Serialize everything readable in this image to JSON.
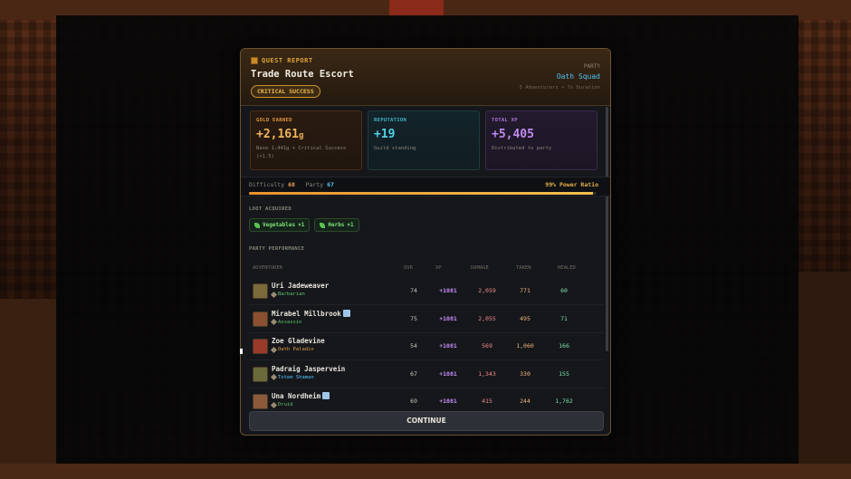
{
  "dialog": {
    "report_label": "QUEST REPORT",
    "quest_title": "Trade Route Escort",
    "outcome": "CRITICAL SUCCESS",
    "party_label": "PARTY",
    "party_name": "Oath Squad",
    "party_meta": "5 Adventurers • 7s Duration"
  },
  "stats": {
    "gold": {
      "label": "GOLD EARNED",
      "value": "+2,161",
      "unit": "g",
      "note": "Base 1,441g + Critical Success (×1.5)",
      "color": "#f0b45a"
    },
    "reputation": {
      "label": "REPUTATION",
      "value": "+19",
      "note": "Guild standing",
      "color": "#4fd2e6"
    },
    "xp": {
      "label": "TOTAL XP",
      "value": "+5,405",
      "note": "Distributed to party",
      "color": "#c08af0"
    }
  },
  "power": {
    "difficulty_label": "Difficulty",
    "difficulty": "68",
    "party_label": "Party",
    "party": "67",
    "ratio_text": "99% Power Ratio",
    "ratio": 0.99
  },
  "loot": {
    "label": "LOOT ACQUIRED",
    "items": [
      {
        "label": "Vegetables",
        "qty": "×1"
      },
      {
        "label": "Herbs",
        "qty": "×1"
      }
    ]
  },
  "performance": {
    "label": "PARTY PERFORMANCE",
    "columns": {
      "adventurer": "ADVENTURER",
      "ovr": "OVR",
      "xp": "XP",
      "damage": "DAMAGE",
      "taken": "TAKEN",
      "healed": "HEALED"
    },
    "rows": [
      {
        "name": "Uri Jadeweaver",
        "verified": false,
        "class": "Barbarian",
        "class_color": "#5ec46a",
        "ovr": "74",
        "xp": "+1081",
        "damage": "2,059",
        "taken": "771",
        "healed": "60",
        "avatar_color": "#7a6a3a"
      },
      {
        "name": "Mirabel Millbrook",
        "verified": true,
        "class": "Assassin",
        "class_color": "#5ec46a",
        "ovr": "75",
        "xp": "+1081",
        "damage": "2,055",
        "taken": "495",
        "healed": "71",
        "avatar_color": "#8a5030"
      },
      {
        "name": "Zoe Gladevine",
        "verified": false,
        "class": "Oath Paladin",
        "class_color": "#e0a040",
        "ovr": "54",
        "xp": "+1081",
        "damage": "569",
        "taken": "1,060",
        "healed": "166",
        "avatar_color": "#9a3a2a"
      },
      {
        "name": "Padraig Jaspervein",
        "verified": false,
        "class": "Totem Shaman",
        "class_color": "#4fc3f7",
        "ovr": "67",
        "xp": "+1081",
        "damage": "1,343",
        "taken": "330",
        "healed": "155",
        "avatar_color": "#6a6a3a"
      },
      {
        "name": "Una Nordheim",
        "verified": true,
        "class": "Druid",
        "class_color": "#5ec46a",
        "ovr": "69",
        "xp": "+1081",
        "damage": "415",
        "taken": "244",
        "healed": "1,762",
        "avatar_color": "#8a5a3a"
      }
    ]
  },
  "continue_label": "CONTINUE"
}
